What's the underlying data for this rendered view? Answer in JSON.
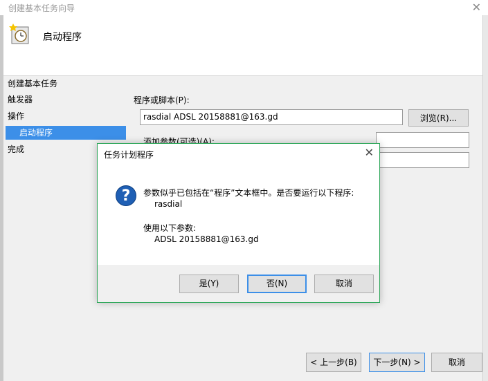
{
  "wizard": {
    "window_title": "创建基本任务向导",
    "header_title": "启动程序",
    "steps_heading": "创建基本任务",
    "steps": [
      "触发器",
      "操作",
      "启动程序",
      "完成"
    ],
    "program_label": "程序或脚本(P):",
    "program_value": "rasdial ADSL 20158881@163.gd",
    "browse_label": "浏览(R)...",
    "args_label": "添加参数(可选)(A):",
    "back_label": "< 上一步(B)",
    "next_label": "下一步(N) >",
    "cancel_label": "取消"
  },
  "dialog": {
    "title": "任务计划程序",
    "message_line1": "参数似乎已包括在“程序”文本框中。是否要运行以下程序:",
    "program": "rasdial",
    "args_label": "使用以下参数:",
    "args_value": "ADSL 20158881@163.gd",
    "yes_label": "是(Y)",
    "no_label": "否(N)",
    "cancel_label": "取消"
  },
  "colors": {
    "selection": "#3c8fe8",
    "dialog_border": "#2fa75a",
    "question_icon": "#1f5fb4"
  }
}
